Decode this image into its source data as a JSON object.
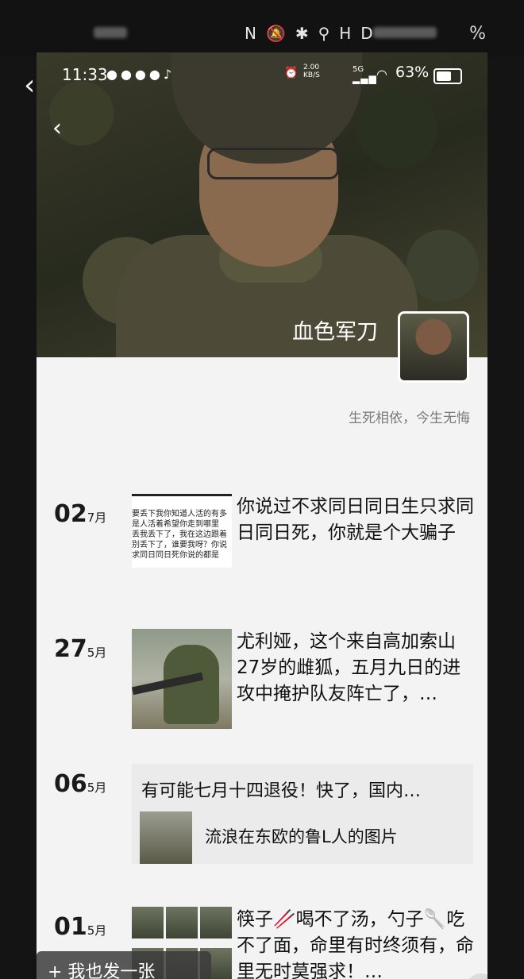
{
  "outer_status": {
    "battery_pct": "%"
  },
  "status": {
    "time": "11:33",
    "network_speed": "2.00 KB/S",
    "signal": "5G",
    "battery": "63%"
  },
  "profile": {
    "username": "血色军刀",
    "motto": "生死相依，今生无悔"
  },
  "posts": [
    {
      "day": "02",
      "month": "7月",
      "text": "你说过不求同日同日生只求同日同日死，你就是个大骗子",
      "thumb_lines": [
        "要丢下我你知道人活的有多",
        "是人活着希望你走到哪里",
        "丢我丢下了，我在这边跟着",
        "别丢下了，谁要我呀？你说",
        "求同日同日死你说的都是"
      ]
    },
    {
      "day": "27",
      "month": "5月",
      "text": "尤利娅，这个来自高加索山27岁的雌狐，五月九日的进攻中掩护队友阵亡了，…"
    },
    {
      "day": "06",
      "month": "5月",
      "text": "有可能七月十四退役！快了，国内…",
      "link": "流浪在东欧的鲁L人的图片"
    },
    {
      "day": "01",
      "month": "5月",
      "text": "筷子🥢喝不了汤，勺子🥄吃不了面，命里有时终须有，命里无时莫强求！…"
    }
  ],
  "bottom": {
    "post_button": "+ 我也发一张"
  }
}
